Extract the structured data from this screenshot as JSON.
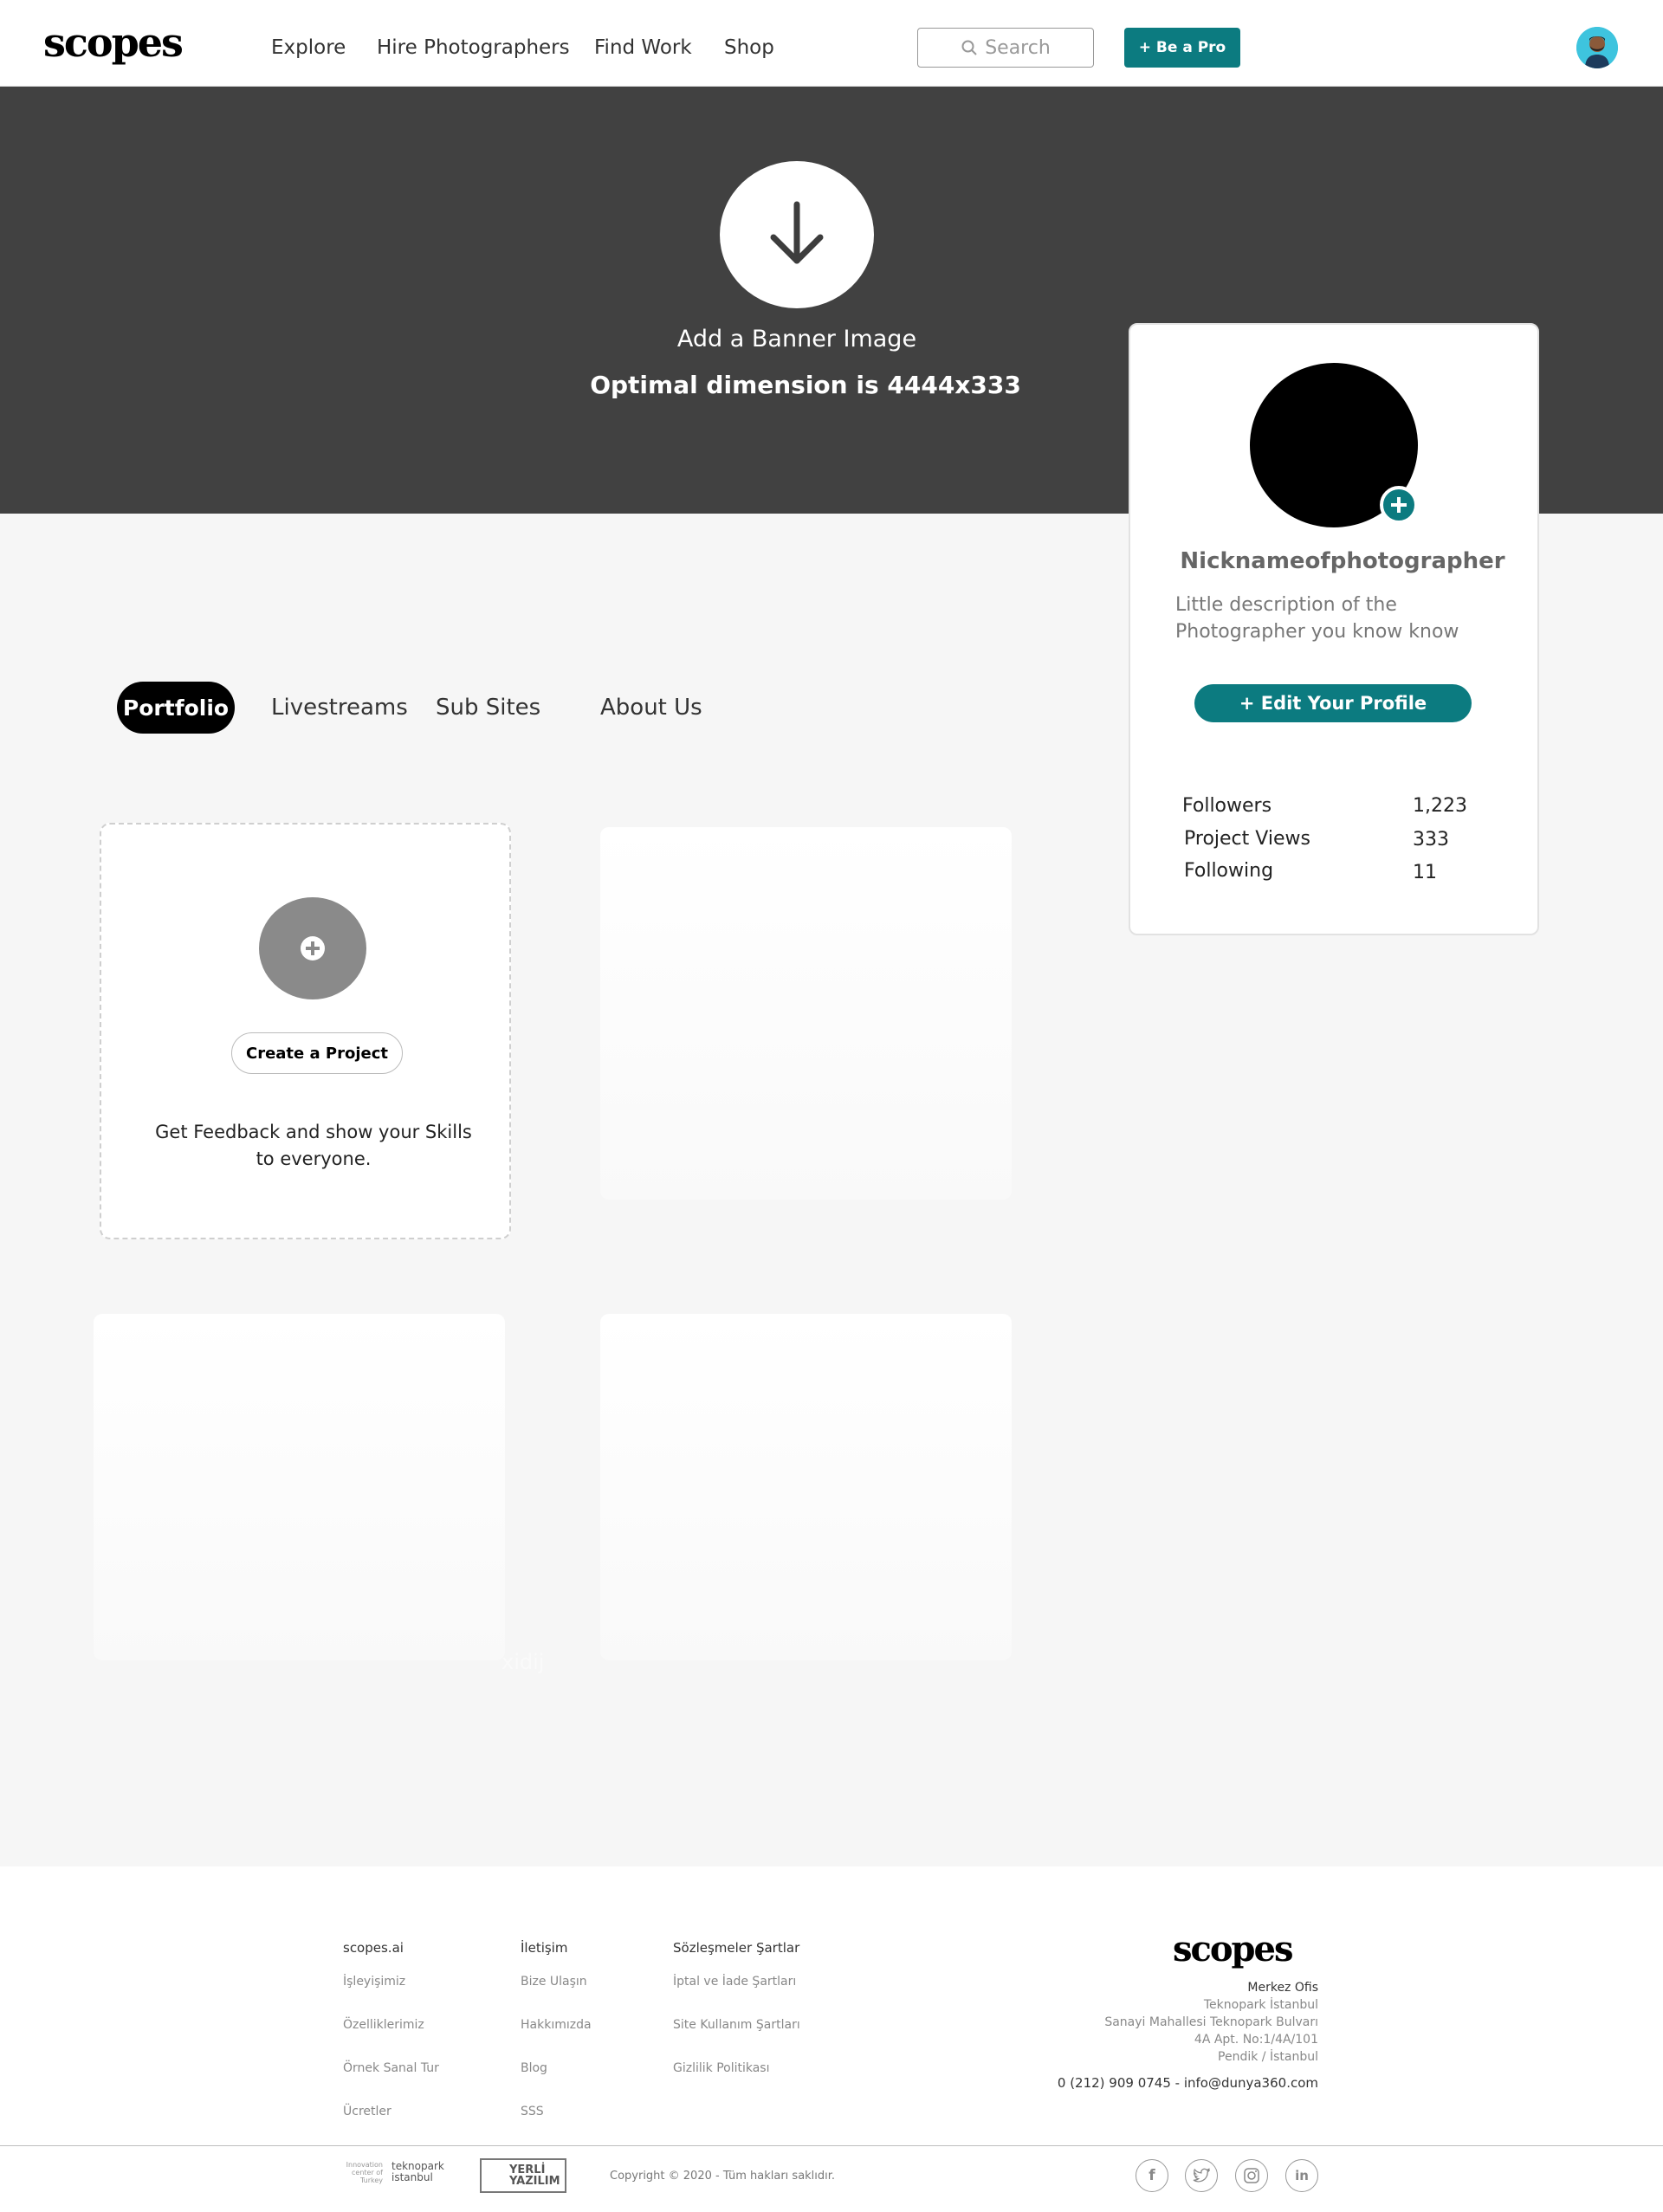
{
  "nav": {
    "logo": "scopes",
    "links": [
      "Explore",
      "Hire Photographers",
      "Find Work",
      "Shop"
    ],
    "search_placeholder": "Search",
    "pro_button": "+ Be a Pro"
  },
  "banner": {
    "line1": "Add a Banner Image",
    "line2": "Optimal dimension is 4444x333"
  },
  "profile": {
    "nickname": "Nicknameofphotographer",
    "description": "Little description of the Photographer you know know",
    "edit_button": "+ Edit Your Profile",
    "stats": [
      {
        "label": "Followers",
        "value": "1,223"
      },
      {
        "label": "Project Views",
        "value": "333"
      },
      {
        "label": "Following",
        "value": "11"
      }
    ]
  },
  "tabs": [
    "Portfolio",
    "Livestreams",
    "Sub Sites",
    "About Us"
  ],
  "create_project": {
    "button": "Create a Project",
    "text": "Get Feedback and show your Skills to everyone."
  },
  "ghost_text": "xidij",
  "footer": {
    "columns": [
      {
        "heading": "scopes.ai",
        "links": [
          "İşleyişimiz",
          "Özelliklerimiz",
          "Örnek Sanal Tur",
          "Ücretler"
        ]
      },
      {
        "heading": "İletişim",
        "links": [
          "Bize Ulaşın",
          "Hakkımızda",
          "Blog",
          "SSS"
        ]
      },
      {
        "heading": "Sözleşmeler Şartlar",
        "links": [
          "İptal ve İade Şartları",
          "Site Kullanım Şartları",
          "Gizlilik Politikası"
        ]
      }
    ],
    "logo": "scopes",
    "address": [
      "Merkez Ofis",
      "Teknopark İstanbul",
      "Sanayi Mahallesi Teknopark Bulvarı",
      "4A Apt. No:1/4A/101",
      "Pendik / İstanbul"
    ],
    "contact": "0 (212) 909 0745 - info@dunya360.com",
    "badge_teknopark": "Innovation center of Turkey",
    "badge_teknopark2": "teknopark istanbul",
    "badge_yerli": "YERLİ YAZILIM",
    "copyright": "Copyright © 2020 - Tüm hakları saklıdır.",
    "social": [
      "facebook-icon",
      "twitter-icon",
      "instagram-icon",
      "linkedin-icon"
    ]
  },
  "colors": {
    "accent": "#0c7b80",
    "banner": "#414141",
    "page_bg": "#f6f6f6"
  }
}
